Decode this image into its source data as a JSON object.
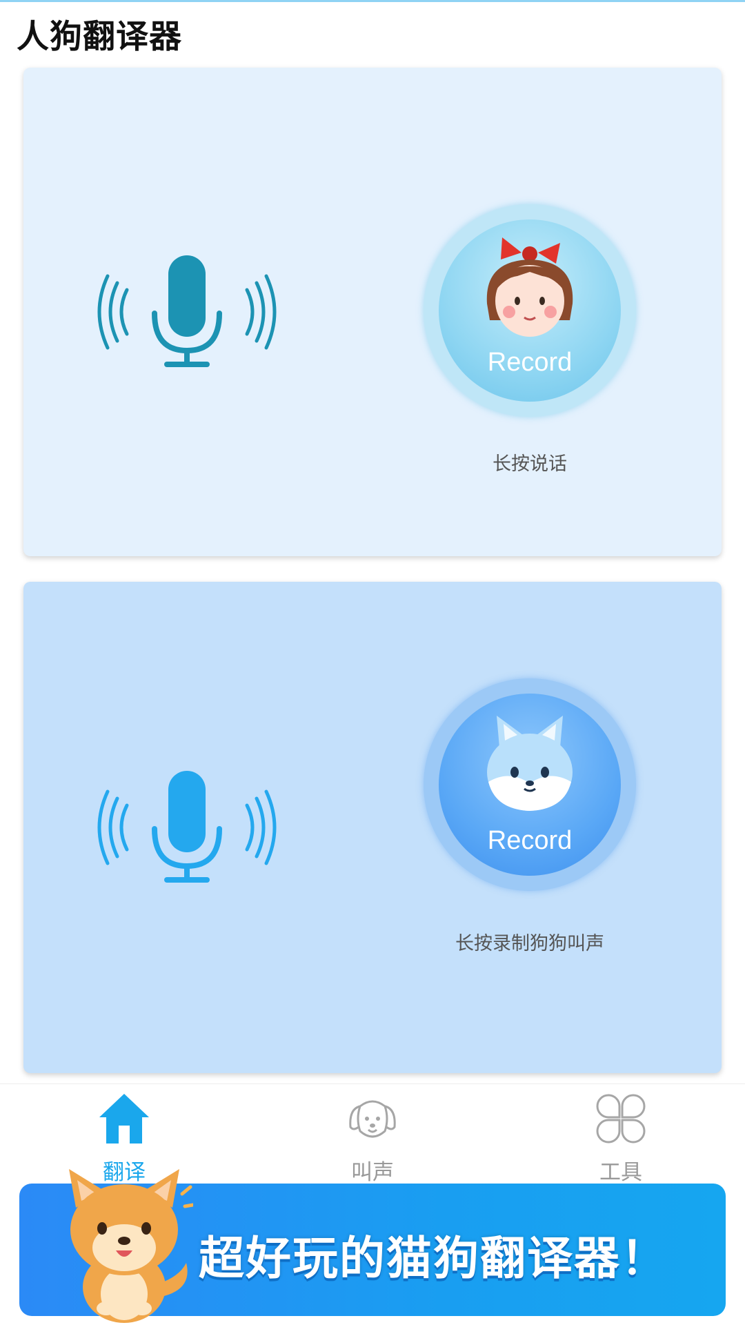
{
  "app": {
    "title": "人狗翻译器"
  },
  "human_panel": {
    "record_label": "Record",
    "hint": "长按说话"
  },
  "dog_panel": {
    "record_label": "Record",
    "hint": "长按录制狗狗叫声"
  },
  "tabbar": {
    "tabs": [
      {
        "label": "翻译",
        "icon": "home-icon",
        "active": true
      },
      {
        "label": "叫声",
        "icon": "dog-face-icon",
        "active": false
      },
      {
        "label": "工具",
        "icon": "grid-icon",
        "active": false
      }
    ]
  },
  "banner": {
    "text": "超好玩的猫狗翻译器！"
  },
  "colors": {
    "accent": "#1aa7ec",
    "human_card": "#e4f1fd",
    "dog_card": "#c4e0fb",
    "banner": "#2b8af6"
  }
}
